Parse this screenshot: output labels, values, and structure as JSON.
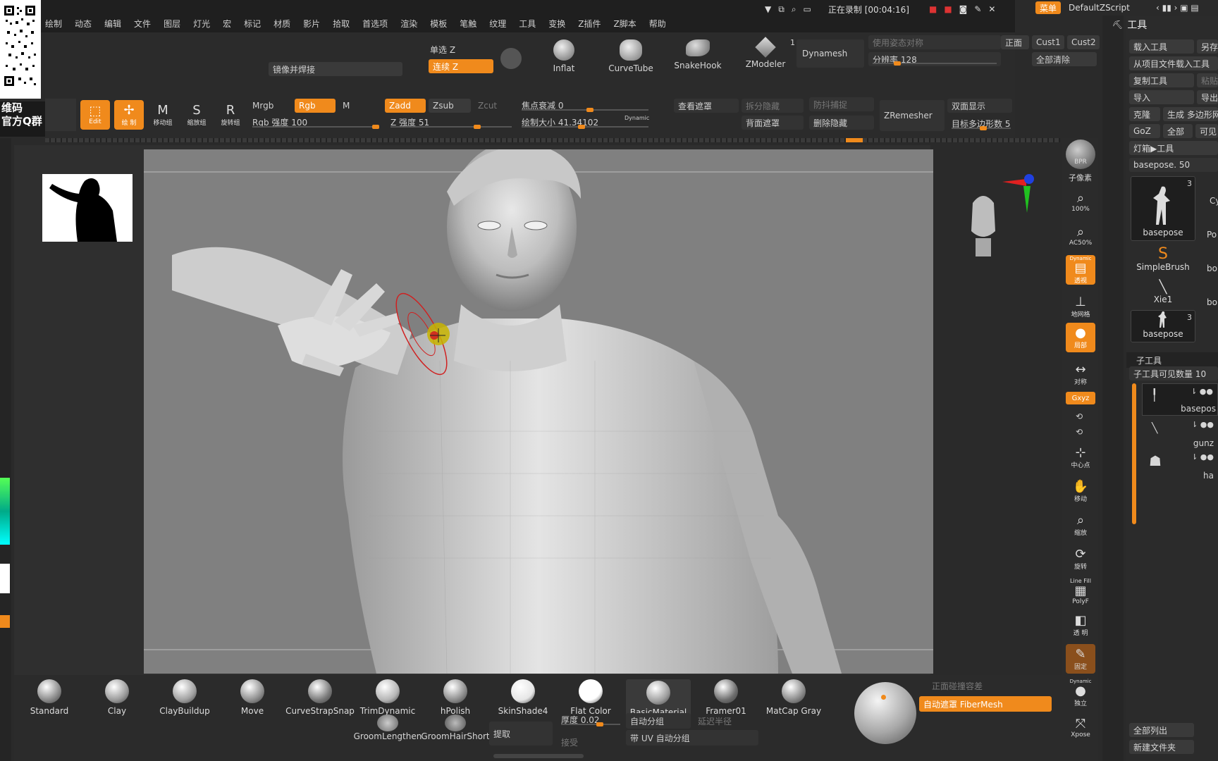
{
  "top_menu": [
    "绘制",
    "动态",
    "编辑",
    "文件",
    "图层",
    "灯光",
    "宏",
    "标记",
    "材质",
    "影片",
    "拾取",
    "首选项",
    "渲染",
    "模板",
    "笔触",
    "纹理",
    "工具",
    "变换",
    "Z插件",
    "Z脚本",
    "帮助"
  ],
  "title_bar": {
    "recording": "正在录制 [00:04:16]",
    "menu": "菜单",
    "script": "DefaultZScript"
  },
  "qr_text": {
    "line1": "维码",
    "line2": "官方Q群"
  },
  "toolbar_top": {
    "mirror_weld": "镜像并焊接",
    "single_z": "单选 Z",
    "continuous_z": "连续 Z",
    "inflat": "Inflat",
    "curvetube": "CurveTube",
    "snakehook": "SnakeHook",
    "zmodeler": "ZModeler",
    "zmodeler_count": "1",
    "dynamesh": "Dynamesh",
    "use_pose_sym": "使用姿态对称",
    "resolution": "分辨率 128",
    "front": "正面",
    "cust1": "Cust1",
    "cust2": "Cust2",
    "clear_all": "全部清除"
  },
  "toolbar_second": {
    "edit": "Edit",
    "draw": "绘 制",
    "move": "移动组",
    "scale": "缩放组",
    "rotate": "旋转组",
    "mrgb": "Mrgb",
    "rgb": "Rgb",
    "m": "M",
    "rgb_intensity": "Rgb 强度 100",
    "zadd": "Zadd",
    "zsub": "Zsub",
    "zcut": "Zcut",
    "z_intensity": "Z 强度 51",
    "focal_shift": "焦点衰减 0",
    "draw_size": "绘制大小 41.34102",
    "dynamic": "Dynamic",
    "view_mask": "查看遮罩",
    "back_mask": "背面遮罩",
    "split_hidden": "拆分隐藏",
    "delete_hidden": "删除隐藏",
    "anti_capture": "防抖捕捉",
    "zremesher": "ZRemesher",
    "double_side": "双面显示",
    "target_poly": "目标多边形数 5"
  },
  "right_toolbar": [
    "BPR",
    "子像素",
    "100%",
    "AC50%",
    "透视",
    "地网格",
    "局部",
    "对称",
    "Gxyz",
    "中心点",
    "移动",
    "缩放",
    "旋转",
    "PolyF",
    "透明",
    "固定",
    "Dynamic",
    "独立",
    "Xpose"
  ],
  "right_toolbar_labels": {
    "bpr": "BPR",
    "subpixel": "子像素",
    "zoom100": "100%",
    "ac50": "AC50%",
    "persp_top": "Dynamic",
    "persp": "透视",
    "floor": "地网格",
    "local": "局部",
    "sym": "对称",
    "gxyz": "Gxyz",
    "center": "中心点",
    "move": "移动",
    "scale": "缩放",
    "rotate": "旋转",
    "linefill": "Line Fill",
    "polyf": "PolyF",
    "transp": "透 明",
    "ghost": "固定",
    "dynamic": "Dynamic",
    "solo": "独立",
    "xpose": "Xpose"
  },
  "tool_panel": {
    "title": "工具",
    "load_tool": "载入工具",
    "save_as": "另存",
    "load_from_project": "从项目文件载入工具",
    "copy_tool": "复制工具",
    "paste": "粘贴",
    "import": "导入",
    "export": "导出",
    "clone": "克隆",
    "make_polymesh": "生成 多边形网",
    "goz": "GoZ",
    "all": "全部",
    "visible": "可见",
    "lightbox_tools": "灯箱▶工具",
    "basepose_value": "basepose. 50",
    "thumbs": [
      {
        "label": "basepose",
        "count": "3"
      },
      {
        "label": "SimpleBrush",
        "count": ""
      },
      {
        "label": "Xie1",
        "count": ""
      },
      {
        "label": "basepose",
        "count": "3"
      }
    ],
    "side_labels": [
      "Cy",
      "Po",
      "bo",
      "bo"
    ],
    "subtool_title": "子工具",
    "subtool_visible_count": "子工具可见数量 10",
    "subtools": [
      "basepos",
      "gunz",
      "ha"
    ],
    "list_all": "全部列出",
    "new_folder": "新建文件夹"
  },
  "materials": [
    {
      "name": "Standard",
      "color": "#8a8a8a"
    },
    {
      "name": "Clay",
      "color": "#9a9a9a"
    },
    {
      "name": "ClayBuildup",
      "color": "#a0a0a0"
    },
    {
      "name": "Move",
      "color": "#8f8f8f"
    },
    {
      "name": "CurveStrapSnap",
      "color": "#7a7a7a"
    },
    {
      "name": "TrimDynamic",
      "color": "#b5b5b5"
    },
    {
      "name": "hPolish",
      "color": "#8c8c8c"
    },
    {
      "name": "SkinShade4",
      "color": "#e6e6e6"
    },
    {
      "name": "Flat Color",
      "color": "#ffffff"
    },
    {
      "name": "BasicMaterial",
      "color": "#9d9d9d"
    },
    {
      "name": "Framer01",
      "color": "#6e6e6e"
    },
    {
      "name": "MatCap Gray",
      "color": "#8a8a8a"
    }
  ],
  "bottom_row2": {
    "groom_lengthen": "GroomLengthen",
    "groom_hair_short": "GroomHairShort",
    "extract": "提取",
    "thickness": "厚度 0.02",
    "accept": "接受",
    "auto_group": "自动分组",
    "uv_auto_group": "带 UV 自动分组",
    "delay_radius": "延迟半径",
    "front_capture": "正面碰撞容差",
    "auto_mask_fibermesh": "自动遮罩 FiberMesh"
  }
}
